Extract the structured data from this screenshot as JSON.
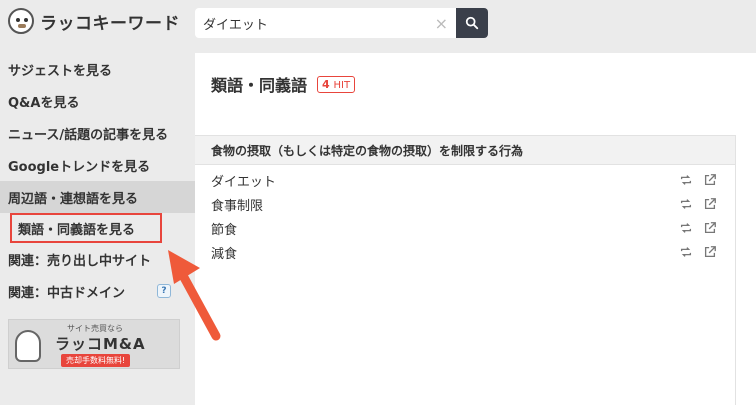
{
  "header": {
    "logo_text": "ラッコキーワード",
    "search_value": "ダイエット",
    "clear_glyph": "×"
  },
  "sidebar": {
    "items": [
      {
        "label": "サジェストを見る"
      },
      {
        "label": "Q&Aを見る"
      },
      {
        "label": "ニュース/話題の記事を見る"
      },
      {
        "label": "Googleトレンドを見る"
      },
      {
        "label": "周辺語・連想語を見る"
      },
      {
        "label": "類語・同義語を見る"
      },
      {
        "label": "関連：売り出し中サイト"
      },
      {
        "label": "関連：中古ドメイン"
      }
    ],
    "badge": "?",
    "banner": {
      "small": "サイト売買なら",
      "main": "ラッコM&A",
      "sub": "売却手数料無料!"
    }
  },
  "main": {
    "title": "類語・同義語",
    "hit_count": "4",
    "hit_label": "HIT",
    "group_heading": "食物の摂取（もしくは特定の食物の摂取）を制限する行為",
    "rows": [
      "ダイエット",
      "食事制限",
      "節食",
      "減食"
    ]
  },
  "icons": {
    "search": "search-icon",
    "repeat": "repeat-icon",
    "external": "external-link-icon"
  },
  "colors": {
    "accent_red": "#e8453c",
    "search_button": "#3a3f4a"
  }
}
